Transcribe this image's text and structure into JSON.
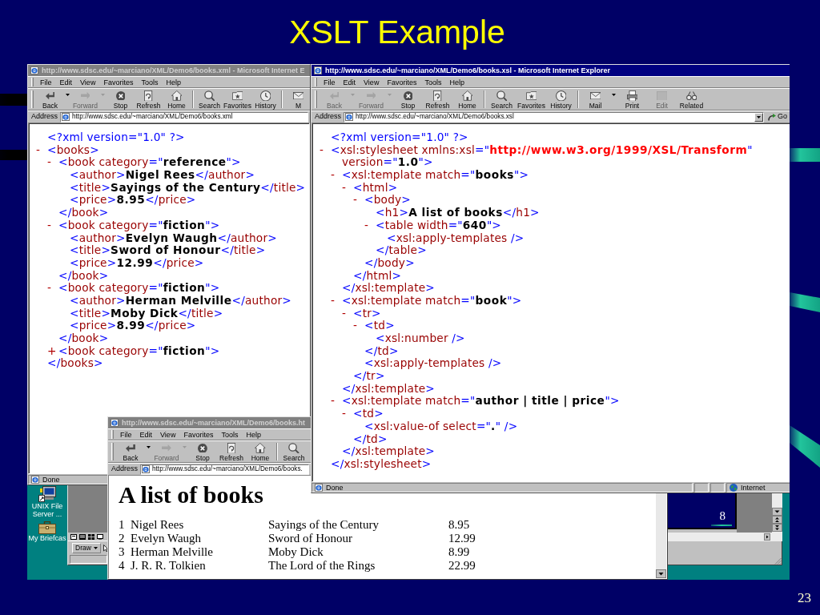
{
  "slide": {
    "title": "XSLT Example",
    "page_number": "23"
  },
  "windows": [
    {
      "title": "http://www.sdsc.edu/~marciano/XML/Demo6/books.xml - Microsoft Internet E",
      "active": false,
      "menu": [
        "File",
        "Edit",
        "View",
        "Favorites",
        "Tools",
        "Help"
      ],
      "toolbar": [
        [
          {
            "kind": "back",
            "label": "Back",
            "disabled": false,
            "dropdown": true
          },
          {
            "kind": "forward",
            "label": "Forward",
            "disabled": true,
            "dropdown": true
          },
          {
            "kind": "stop",
            "label": "Stop",
            "disabled": false,
            "dropdown": false
          },
          {
            "kind": "refresh",
            "label": "Refresh",
            "disabled": false,
            "dropdown": false
          },
          {
            "kind": "home",
            "label": "Home",
            "disabled": false,
            "dropdown": false
          }
        ],
        [
          {
            "kind": "search",
            "label": "Search",
            "disabled": false,
            "dropdown": false
          },
          {
            "kind": "favorites",
            "label": "Favorites",
            "disabled": false,
            "dropdown": false
          },
          {
            "kind": "history",
            "label": "History",
            "disabled": false,
            "dropdown": false
          }
        ],
        [
          {
            "kind": "mail",
            "label": "M",
            "disabled": false,
            "dropdown": false
          }
        ]
      ],
      "address": {
        "label": "Address",
        "url": "http://www.sdsc.edu/~marciano/XML/Demo6/books.xml"
      },
      "content": {
        "kind": "xml_tree",
        "nodes": [
          {
            "lines": [
              [
                {
                  "kind": "markup",
                  "text": "<?xml version=\"1.0\" ?>"
                }
              ]
            ]
          },
          {
            "marker": "-",
            "lines": [
              [
                {
                  "kind": "markup",
                  "text": "<"
                },
                {
                  "kind": "name",
                  "text": "books"
                },
                {
                  "kind": "markup",
                  "text": ">"
                }
              ]
            ],
            "children": [
              {
                "marker": "-",
                "lines": [
                  [
                    {
                      "kind": "markup",
                      "text": "<"
                    },
                    {
                      "kind": "name",
                      "text": "book category"
                    },
                    {
                      "kind": "markup",
                      "text": "=\""
                    },
                    {
                      "kind": "value",
                      "text": "reference"
                    },
                    {
                      "kind": "markup",
                      "text": "\">"
                    }
                  ]
                ],
                "children": [
                  {
                    "lines": [
                      [
                        {
                          "kind": "markup",
                          "text": "<"
                        },
                        {
                          "kind": "name",
                          "text": "author"
                        },
                        {
                          "kind": "markup",
                          "text": ">"
                        },
                        {
                          "kind": "text",
                          "text": "Nigel Rees"
                        },
                        {
                          "kind": "markup",
                          "text": "</"
                        },
                        {
                          "kind": "name",
                          "text": "author"
                        },
                        {
                          "kind": "markup",
                          "text": ">"
                        }
                      ]
                    ]
                  },
                  {
                    "lines": [
                      [
                        {
                          "kind": "markup",
                          "text": "<"
                        },
                        {
                          "kind": "name",
                          "text": "title"
                        },
                        {
                          "kind": "markup",
                          "text": ">"
                        },
                        {
                          "kind": "text",
                          "text": "Sayings of the Century"
                        },
                        {
                          "kind": "markup",
                          "text": "</"
                        },
                        {
                          "kind": "name",
                          "text": "title"
                        },
                        {
                          "kind": "markup",
                          "text": ">"
                        }
                      ]
                    ]
                  },
                  {
                    "lines": [
                      [
                        {
                          "kind": "markup",
                          "text": "<"
                        },
                        {
                          "kind": "name",
                          "text": "price"
                        },
                        {
                          "kind": "markup",
                          "text": ">"
                        },
                        {
                          "kind": "text",
                          "text": "8.95"
                        },
                        {
                          "kind": "markup",
                          "text": "</"
                        },
                        {
                          "kind": "name",
                          "text": "price"
                        },
                        {
                          "kind": "markup",
                          "text": ">"
                        }
                      ]
                    ]
                  }
                ],
                "close": [
                  {
                    "kind": "markup",
                    "text": "</"
                  },
                  {
                    "kind": "name",
                    "text": "book"
                  },
                  {
                    "kind": "markup",
                    "text": ">"
                  }
                ]
              },
              {
                "marker": "-",
                "lines": [
                  [
                    {
                      "kind": "markup",
                      "text": "<"
                    },
                    {
                      "kind": "name",
                      "text": "book category"
                    },
                    {
                      "kind": "markup",
                      "text": "=\""
                    },
                    {
                      "kind": "value",
                      "text": "fiction"
                    },
                    {
                      "kind": "markup",
                      "text": "\">"
                    }
                  ]
                ],
                "children": [
                  {
                    "lines": [
                      [
                        {
                          "kind": "markup",
                          "text": "<"
                        },
                        {
                          "kind": "name",
                          "text": "author"
                        },
                        {
                          "kind": "markup",
                          "text": ">"
                        },
                        {
                          "kind": "text",
                          "text": "Evelyn Waugh"
                        },
                        {
                          "kind": "markup",
                          "text": "</"
                        },
                        {
                          "kind": "name",
                          "text": "author"
                        },
                        {
                          "kind": "markup",
                          "text": ">"
                        }
                      ]
                    ]
                  },
                  {
                    "lines": [
                      [
                        {
                          "kind": "markup",
                          "text": "<"
                        },
                        {
                          "kind": "name",
                          "text": "title"
                        },
                        {
                          "kind": "markup",
                          "text": ">"
                        },
                        {
                          "kind": "text",
                          "text": "Sword of Honour"
                        },
                        {
                          "kind": "markup",
                          "text": "</"
                        },
                        {
                          "kind": "name",
                          "text": "title"
                        },
                        {
                          "kind": "markup",
                          "text": ">"
                        }
                      ]
                    ]
                  },
                  {
                    "lines": [
                      [
                        {
                          "kind": "markup",
                          "text": "<"
                        },
                        {
                          "kind": "name",
                          "text": "price"
                        },
                        {
                          "kind": "markup",
                          "text": ">"
                        },
                        {
                          "kind": "text",
                          "text": "12.99"
                        },
                        {
                          "kind": "markup",
                          "text": "</"
                        },
                        {
                          "kind": "name",
                          "text": "price"
                        },
                        {
                          "kind": "markup",
                          "text": ">"
                        }
                      ]
                    ]
                  }
                ],
                "close": [
                  {
                    "kind": "markup",
                    "text": "</"
                  },
                  {
                    "kind": "name",
                    "text": "book"
                  },
                  {
                    "kind": "markup",
                    "text": ">"
                  }
                ]
              },
              {
                "marker": "-",
                "lines": [
                  [
                    {
                      "kind": "markup",
                      "text": "<"
                    },
                    {
                      "kind": "name",
                      "text": "book category"
                    },
                    {
                      "kind": "markup",
                      "text": "=\""
                    },
                    {
                      "kind": "value",
                      "text": "fiction"
                    },
                    {
                      "kind": "markup",
                      "text": "\">"
                    }
                  ]
                ],
                "children": [
                  {
                    "lines": [
                      [
                        {
                          "kind": "markup",
                          "text": "<"
                        },
                        {
                          "kind": "name",
                          "text": "author"
                        },
                        {
                          "kind": "markup",
                          "text": ">"
                        },
                        {
                          "kind": "text",
                          "text": "Herman Melville"
                        },
                        {
                          "kind": "markup",
                          "text": "</"
                        },
                        {
                          "kind": "name",
                          "text": "author"
                        },
                        {
                          "kind": "markup",
                          "text": ">"
                        }
                      ]
                    ]
                  },
                  {
                    "lines": [
                      [
                        {
                          "kind": "markup",
                          "text": "<"
                        },
                        {
                          "kind": "name",
                          "text": "title"
                        },
                        {
                          "kind": "markup",
                          "text": ">"
                        },
                        {
                          "kind": "text",
                          "text": "Moby Dick"
                        },
                        {
                          "kind": "markup",
                          "text": "</"
                        },
                        {
                          "kind": "name",
                          "text": "title"
                        },
                        {
                          "kind": "markup",
                          "text": ">"
                        }
                      ]
                    ]
                  },
                  {
                    "lines": [
                      [
                        {
                          "kind": "markup",
                          "text": "<"
                        },
                        {
                          "kind": "name",
                          "text": "price"
                        },
                        {
                          "kind": "markup",
                          "text": ">"
                        },
                        {
                          "kind": "text",
                          "text": "8.99"
                        },
                        {
                          "kind": "markup",
                          "text": "</"
                        },
                        {
                          "kind": "name",
                          "text": "price"
                        },
                        {
                          "kind": "markup",
                          "text": ">"
                        }
                      ]
                    ]
                  }
                ],
                "close": [
                  {
                    "kind": "markup",
                    "text": "</"
                  },
                  {
                    "kind": "name",
                    "text": "book"
                  },
                  {
                    "kind": "markup",
                    "text": ">"
                  }
                ]
              },
              {
                "marker": "+",
                "lines": [
                  [
                    {
                      "kind": "markup",
                      "text": "<"
                    },
                    {
                      "kind": "name",
                      "text": "book category"
                    },
                    {
                      "kind": "markup",
                      "text": "=\""
                    },
                    {
                      "kind": "value",
                      "text": "fiction"
                    },
                    {
                      "kind": "markup",
                      "text": "\">"
                    }
                  ]
                ]
              }
            ],
            "close": [
              {
                "kind": "markup",
                "text": "</"
              },
              {
                "kind": "name",
                "text": "books"
              },
              {
                "kind": "markup",
                "text": ">"
              }
            ]
          }
        ]
      },
      "status_bar": {
        "text": "Done"
      }
    },
    {
      "title": "http://www.sdsc.edu/~marciano/XML/Demo6/books.xsl - Microsoft Internet Explorer",
      "active": true,
      "menu": [
        "File",
        "Edit",
        "View",
        "Favorites",
        "Tools",
        "Help"
      ],
      "toolbar": [
        [
          {
            "kind": "back",
            "label": "Back",
            "disabled": true,
            "dropdown": true
          },
          {
            "kind": "forward",
            "label": "Forward",
            "disabled": true,
            "dropdown": true
          },
          {
            "kind": "stop",
            "label": "Stop",
            "disabled": false,
            "dropdown": false
          },
          {
            "kind": "refresh",
            "label": "Refresh",
            "disabled": false,
            "dropdown": false
          },
          {
            "kind": "home",
            "label": "Home",
            "disabled": false,
            "dropdown": false
          }
        ],
        [
          {
            "kind": "search",
            "label": "Search",
            "disabled": false,
            "dropdown": false
          },
          {
            "kind": "favorites",
            "label": "Favorites",
            "disabled": false,
            "dropdown": false
          },
          {
            "kind": "history",
            "label": "History",
            "disabled": false,
            "dropdown": false
          }
        ],
        [
          {
            "kind": "mail",
            "label": "Mail",
            "disabled": false,
            "dropdown": true
          },
          {
            "kind": "print",
            "label": "Print",
            "disabled": false,
            "dropdown": false
          },
          {
            "kind": "edit",
            "label": "Edit",
            "disabled": true,
            "dropdown": false
          },
          {
            "kind": "related",
            "label": "Related",
            "disabled": false,
            "dropdown": false
          }
        ]
      ],
      "address": {
        "label": "Address",
        "url": "http://www.sdsc.edu/~marciano/XML/Demo6/books.xsl",
        "dropdown": true,
        "go": "Go"
      },
      "content": {
        "kind": "xml_tree",
        "nodes": [
          {
            "lines": [
              [
                {
                  "kind": "markup",
                  "text": "<?xml version=\"1.0\" ?>"
                }
              ]
            ]
          },
          {
            "marker": "-",
            "lines": [
              [
                {
                  "kind": "markup",
                  "text": "<"
                },
                {
                  "kind": "name",
                  "text": "xsl:stylesheet xmlns:xsl"
                },
                {
                  "kind": "markup",
                  "text": "=\""
                },
                {
                  "kind": "ns_value",
                  "text": "http://www.w3.org/1999/XSL/Transform"
                },
                {
                  "kind": "markup",
                  "text": "\""
                }
              ],
              [
                {
                  "kind": "name",
                  "text": "version"
                },
                {
                  "kind": "markup",
                  "text": "=\""
                },
                {
                  "kind": "value",
                  "text": "1.0"
                },
                {
                  "kind": "markup",
                  "text": "\">"
                }
              ]
            ],
            "children": [
              {
                "marker": "-",
                "lines": [
                  [
                    {
                      "kind": "markup",
                      "text": "<"
                    },
                    {
                      "kind": "name",
                      "text": "xsl:template match"
                    },
                    {
                      "kind": "markup",
                      "text": "=\""
                    },
                    {
                      "kind": "value",
                      "text": "books"
                    },
                    {
                      "kind": "markup",
                      "text": "\">"
                    }
                  ]
                ],
                "children": [
                  {
                    "marker": "-",
                    "lines": [
                      [
                        {
                          "kind": "markup",
                          "text": "<"
                        },
                        {
                          "kind": "name",
                          "text": "html"
                        },
                        {
                          "kind": "markup",
                          "text": ">"
                        }
                      ]
                    ],
                    "children": [
                      {
                        "marker": "-",
                        "lines": [
                          [
                            {
                              "kind": "markup",
                              "text": "<"
                            },
                            {
                              "kind": "name",
                              "text": "body"
                            },
                            {
                              "kind": "markup",
                              "text": ">"
                            }
                          ]
                        ],
                        "children": [
                          {
                            "lines": [
                              [
                                {
                                  "kind": "markup",
                                  "text": "<"
                                },
                                {
                                  "kind": "name",
                                  "text": "h1"
                                },
                                {
                                  "kind": "markup",
                                  "text": ">"
                                },
                                {
                                  "kind": "text",
                                  "text": "A list of books"
                                },
                                {
                                  "kind": "markup",
                                  "text": "</"
                                },
                                {
                                  "kind": "name",
                                  "text": "h1"
                                },
                                {
                                  "kind": "markup",
                                  "text": ">"
                                }
                              ]
                            ]
                          },
                          {
                            "marker": "-",
                            "lines": [
                              [
                                {
                                  "kind": "markup",
                                  "text": "<"
                                },
                                {
                                  "kind": "name",
                                  "text": "table width"
                                },
                                {
                                  "kind": "markup",
                                  "text": "=\""
                                },
                                {
                                  "kind": "value",
                                  "text": "640"
                                },
                                {
                                  "kind": "markup",
                                  "text": "\">"
                                }
                              ]
                            ],
                            "children": [
                              {
                                "lines": [
                                  [
                                    {
                                      "kind": "markup",
                                      "text": "<"
                                    },
                                    {
                                      "kind": "name",
                                      "text": "xsl:apply-templates"
                                    },
                                    {
                                      "kind": "markup",
                                      "text": " />"
                                    }
                                  ]
                                ]
                              }
                            ],
                            "close": [
                              {
                                "kind": "markup",
                                "text": "</"
                              },
                              {
                                "kind": "name",
                                "text": "table"
                              },
                              {
                                "kind": "markup",
                                "text": ">"
                              }
                            ]
                          }
                        ],
                        "close": [
                          {
                            "kind": "markup",
                            "text": "</"
                          },
                          {
                            "kind": "name",
                            "text": "body"
                          },
                          {
                            "kind": "markup",
                            "text": ">"
                          }
                        ]
                      }
                    ],
                    "close": [
                      {
                        "kind": "markup",
                        "text": "</"
                      },
                      {
                        "kind": "name",
                        "text": "html"
                      },
                      {
                        "kind": "markup",
                        "text": ">"
                      }
                    ]
                  }
                ],
                "close": [
                  {
                    "kind": "markup",
                    "text": "</"
                  },
                  {
                    "kind": "name",
                    "text": "xsl:template"
                  },
                  {
                    "kind": "markup",
                    "text": ">"
                  }
                ]
              },
              {
                "marker": "-",
                "lines": [
                  [
                    {
                      "kind": "markup",
                      "text": "<"
                    },
                    {
                      "kind": "name",
                      "text": "xsl:template match"
                    },
                    {
                      "kind": "markup",
                      "text": "=\""
                    },
                    {
                      "kind": "value",
                      "text": "book"
                    },
                    {
                      "kind": "markup",
                      "text": "\">"
                    }
                  ]
                ],
                "children": [
                  {
                    "marker": "-",
                    "lines": [
                      [
                        {
                          "kind": "markup",
                          "text": "<"
                        },
                        {
                          "kind": "name",
                          "text": "tr"
                        },
                        {
                          "kind": "markup",
                          "text": ">"
                        }
                      ]
                    ],
                    "children": [
                      {
                        "marker": "-",
                        "lines": [
                          [
                            {
                              "kind": "markup",
                              "text": "<"
                            },
                            {
                              "kind": "name",
                              "text": "td"
                            },
                            {
                              "kind": "markup",
                              "text": ">"
                            }
                          ]
                        ],
                        "children": [
                          {
                            "lines": [
                              [
                                {
                                  "kind": "markup",
                                  "text": "<"
                                },
                                {
                                  "kind": "name",
                                  "text": "xsl:number"
                                },
                                {
                                  "kind": "markup",
                                  "text": " />"
                                }
                              ]
                            ]
                          }
                        ],
                        "close": [
                          {
                            "kind": "markup",
                            "text": "</"
                          },
                          {
                            "kind": "name",
                            "text": "td"
                          },
                          {
                            "kind": "markup",
                            "text": ">"
                          }
                        ]
                      },
                      {
                        "lines": [
                          [
                            {
                              "kind": "markup",
                              "text": "<"
                            },
                            {
                              "kind": "name",
                              "text": "xsl:apply-templates"
                            },
                            {
                              "kind": "markup",
                              "text": " />"
                            }
                          ]
                        ]
                      }
                    ],
                    "close": [
                      {
                        "kind": "markup",
                        "text": "</"
                      },
                      {
                        "kind": "name",
                        "text": "tr"
                      },
                      {
                        "kind": "markup",
                        "text": ">"
                      }
                    ]
                  }
                ],
                "close": [
                  {
                    "kind": "markup",
                    "text": "</"
                  },
                  {
                    "kind": "name",
                    "text": "xsl:template"
                  },
                  {
                    "kind": "markup",
                    "text": ">"
                  }
                ]
              },
              {
                "marker": "-",
                "lines": [
                  [
                    {
                      "kind": "markup",
                      "text": "<"
                    },
                    {
                      "kind": "name",
                      "text": "xsl:template match"
                    },
                    {
                      "kind": "markup",
                      "text": "=\""
                    },
                    {
                      "kind": "value",
                      "text": "author | title | price"
                    },
                    {
                      "kind": "markup",
                      "text": "\">"
                    }
                  ]
                ],
                "children": [
                  {
                    "marker": "-",
                    "lines": [
                      [
                        {
                          "kind": "markup",
                          "text": "<"
                        },
                        {
                          "kind": "name",
                          "text": "td"
                        },
                        {
                          "kind": "markup",
                          "text": ">"
                        }
                      ]
                    ],
                    "children": [
                      {
                        "lines": [
                          [
                            {
                              "kind": "markup",
                              "text": "<"
                            },
                            {
                              "kind": "name",
                              "text": "xsl:value-of select"
                            },
                            {
                              "kind": "markup",
                              "text": "=\""
                            },
                            {
                              "kind": "value",
                              "text": "."
                            },
                            {
                              "kind": "markup",
                              "text": "\" />"
                            }
                          ]
                        ]
                      }
                    ],
                    "close": [
                      {
                        "kind": "markup",
                        "text": "</"
                      },
                      {
                        "kind": "name",
                        "text": "td"
                      },
                      {
                        "kind": "markup",
                        "text": ">"
                      }
                    ]
                  }
                ],
                "close": [
                  {
                    "kind": "markup",
                    "text": "</"
                  },
                  {
                    "kind": "name",
                    "text": "xsl:template"
                  },
                  {
                    "kind": "markup",
                    "text": ">"
                  }
                ]
              }
            ],
            "close": [
              {
                "kind": "markup",
                "text": "</"
              },
              {
                "kind": "name",
                "text": "xsl:stylesheet"
              },
              {
                "kind": "markup",
                "text": ">"
              }
            ]
          }
        ]
      },
      "status_bar": {
        "text": "Done",
        "zone": "Internet"
      }
    },
    {
      "title": "http://www.sdsc.edu/~marciano/XML/Demo6/books.ht",
      "active": false,
      "menu": [
        "File",
        "Edit",
        "View",
        "Favorites",
        "Tools",
        "Help"
      ],
      "toolbar": [
        [
          {
            "kind": "back",
            "label": "Back",
            "disabled": false,
            "dropdown": true
          },
          {
            "kind": "forward",
            "label": "Forward",
            "disabled": true,
            "dropdown": true
          },
          {
            "kind": "stop",
            "label": "Stop",
            "disabled": false,
            "dropdown": false
          },
          {
            "kind": "refresh",
            "label": "Refresh",
            "disabled": false,
            "dropdown": false
          },
          {
            "kind": "home",
            "label": "Home",
            "disabled": false,
            "dropdown": false
          }
        ],
        [
          {
            "kind": "search",
            "label": "Search",
            "disabled": false,
            "dropdown": false
          }
        ]
      ],
      "address": {
        "label": "Address",
        "url": "http://www.sdsc.edu/~marciano/XML/Demo6/books."
      },
      "content": {
        "kind": "html_page",
        "heading": "A list of books",
        "rows": [
          [
            "1",
            "Nigel Rees",
            "Sayings of the Century",
            "8.95"
          ],
          [
            "2",
            "Evelyn Waugh",
            "Sword of Honour",
            "12.99"
          ],
          [
            "3",
            "Herman Melville",
            "Moby Dick",
            "8.99"
          ],
          [
            "4",
            "J. R. R. Tolkien",
            "The Lord of the Rings",
            "22.99"
          ]
        ]
      }
    }
  ],
  "desktop": {
    "icons": [
      {
        "kind": "computer",
        "label": "UNIX File Server ..."
      },
      {
        "kind": "briefcase",
        "label": "My Briefcas"
      }
    ],
    "presentation_window": {
      "draw_menu": "Draw",
      "slide_number": "8"
    }
  }
}
